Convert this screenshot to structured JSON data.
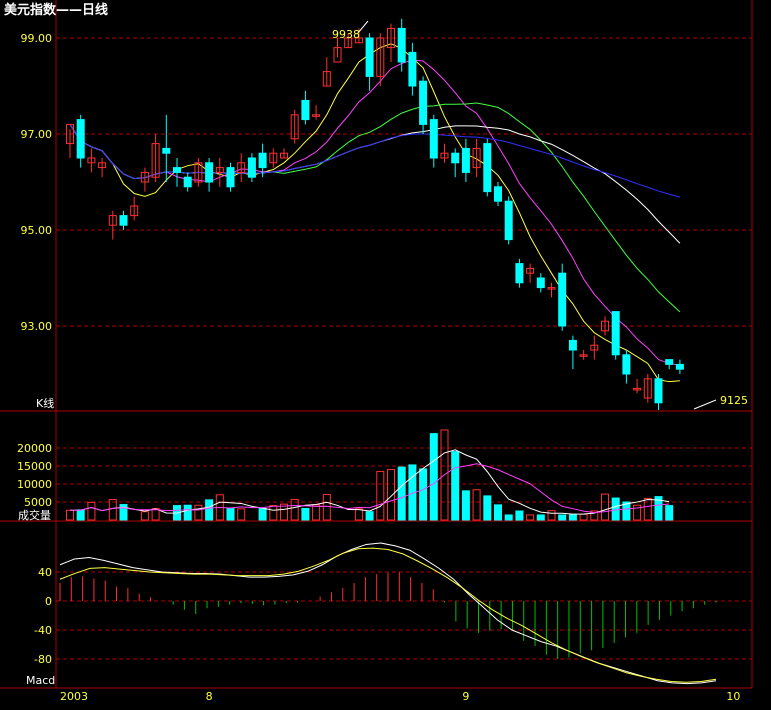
{
  "chart_data": {
    "type": "candlestick",
    "title": "美元指数——日线",
    "kline_label": "K线",
    "volume_label": "成交量",
    "macd_label": "Macd",
    "annotations": {
      "high": "9938",
      "low": "9125"
    },
    "price_axis": {
      "ticks": [
        "99.00",
        "97.00",
        "95.00",
        "93.00"
      ],
      "ylim": [
        91.0,
        99.6
      ]
    },
    "volume_axis": {
      "ticks": [
        "20000",
        "15000",
        "10000",
        "5000"
      ],
      "ylim": [
        0,
        25000
      ]
    },
    "macd_axis": {
      "ticks": [
        "40",
        "0",
        "-40",
        "-80"
      ],
      "ylim": [
        -116,
        80
      ]
    },
    "x_labels": [
      "2003",
      "8",
      "9",
      "10"
    ],
    "x_label_index": [
      0,
      13,
      37,
      62
    ],
    "colors": {
      "up": "#ff3030",
      "down": "#00ffff",
      "ma5": "#ffff40",
      "ma10": "#ff40ff",
      "ma20": "#40ff40",
      "ma30": "#ffffff",
      "ma60": "#3030ff",
      "macd_pos": "#ff3030",
      "macd_neg": "#00c000",
      "frame": "#b00000",
      "axis_text": "#ffff40",
      "label": "#ffffff"
    },
    "candles": [
      [
        96.8,
        97.2,
        96.5,
        97.1
      ],
      [
        97.3,
        96.5,
        96.3,
        97.4
      ],
      [
        96.4,
        96.5,
        96.2,
        96.7
      ],
      [
        96.3,
        96.4,
        96.1,
        96.5
      ],
      [
        95.1,
        95.3,
        94.8,
        95.4
      ],
      [
        95.3,
        95.1,
        95.0,
        95.4
      ],
      [
        95.3,
        95.5,
        95.2,
        95.7
      ],
      [
        96.0,
        96.2,
        95.8,
        96.3
      ],
      [
        96.1,
        96.8,
        96.0,
        97.0
      ],
      [
        96.7,
        96.6,
        96.0,
        97.4
      ],
      [
        96.3,
        96.2,
        95.9,
        96.5
      ],
      [
        96.1,
        95.9,
        95.8,
        96.2
      ],
      [
        96.0,
        96.4,
        95.9,
        96.5
      ],
      [
        96.4,
        96.0,
        95.8,
        96.5
      ],
      [
        96.2,
        96.3,
        95.9,
        96.5
      ],
      [
        96.3,
        95.9,
        95.8,
        96.4
      ],
      [
        96.2,
        96.4,
        96.0,
        96.6
      ],
      [
        96.5,
        96.1,
        96.0,
        96.6
      ],
      [
        96.6,
        96.3,
        96.1,
        96.8
      ],
      [
        96.4,
        96.6,
        96.3,
        96.7
      ],
      [
        96.5,
        96.6,
        96.5,
        96.7
      ],
      [
        96.9,
        97.4,
        96.8,
        97.5
      ],
      [
        97.7,
        97.3,
        97.2,
        97.9
      ],
      [
        97.4,
        97.4,
        97.3,
        97.6
      ],
      [
        98.0,
        98.3,
        98.0,
        98.6
      ],
      [
        98.5,
        98.8,
        98.6,
        99.0
      ],
      [
        98.8,
        99.0,
        98.8,
        99.1
      ],
      [
        98.9,
        99.0,
        98.9,
        99.2
      ],
      [
        99.0,
        98.2,
        97.9,
        99.1
      ],
      [
        98.2,
        99.0,
        98.0,
        99.1
      ],
      [
        98.8,
        99.2,
        98.5,
        99.3
      ],
      [
        99.2,
        98.5,
        98.3,
        99.4
      ],
      [
        98.7,
        98.0,
        97.8,
        98.9
      ],
      [
        98.1,
        97.2,
        97.0,
        98.2
      ],
      [
        97.3,
        96.5,
        96.3,
        97.4
      ],
      [
        96.5,
        96.6,
        96.4,
        96.8
      ],
      [
        96.6,
        96.4,
        96.1,
        96.7
      ],
      [
        96.7,
        96.2,
        96.0,
        96.9
      ],
      [
        96.3,
        96.7,
        96.1,
        96.9
      ],
      [
        96.8,
        95.8,
        95.7,
        96.9
      ],
      [
        95.9,
        95.6,
        95.5,
        96.0
      ],
      [
        95.6,
        94.8,
        94.7,
        95.7
      ],
      [
        94.3,
        93.9,
        93.8,
        94.4
      ],
      [
        94.1,
        94.2,
        93.9,
        94.3
      ],
      [
        94.0,
        93.8,
        93.7,
        94.1
      ],
      [
        93.8,
        93.8,
        93.6,
        93.9
      ],
      [
        94.1,
        93.0,
        92.9,
        94.3
      ],
      [
        92.7,
        92.5,
        92.1,
        92.8
      ],
      [
        92.4,
        92.4,
        92.3,
        92.5
      ],
      [
        92.5,
        92.6,
        92.3,
        92.8
      ],
      [
        92.9,
        93.1,
        92.8,
        93.2
      ],
      [
        93.3,
        92.4,
        92.3,
        93.3
      ],
      [
        92.4,
        92.0,
        91.8,
        92.5
      ],
      [
        91.7,
        91.7,
        91.6,
        91.9
      ],
      [
        91.5,
        91.9,
        91.4,
        92.0
      ],
      [
        91.9,
        91.4,
        91.25,
        92.0
      ],
      [
        92.3,
        92.2,
        92.1,
        92.3
      ],
      [
        92.2,
        92.1,
        92.0,
        92.3
      ]
    ],
    "volume": [
      2700,
      2800,
      4900,
      0,
      5700,
      4300,
      0,
      2300,
      3200,
      0,
      4000,
      4100,
      4100,
      5600,
      7000,
      3200,
      3100,
      0,
      3200,
      4000,
      4400,
      5700,
      3200,
      4200,
      7100,
      0,
      0,
      3100,
      2300,
      13500,
      14000,
      14700,
      15300,
      14200,
      24000,
      25000,
      19000,
      8100,
      8400,
      6700,
      4200,
      1400,
      2500,
      1400,
      1400,
      2600,
      1400,
      1400,
      1600,
      2500,
      7200,
      6100,
      5000,
      4100,
      6000,
      6500,
      4000
    ],
    "macd_hist": [
      25,
      33,
      34,
      31,
      28,
      20,
      18,
      10,
      5,
      0,
      -5,
      -12,
      -18,
      -10,
      -8,
      -5,
      -3,
      -4,
      -6,
      -5,
      -3,
      -2,
      0,
      6,
      12,
      18,
      25,
      33,
      37,
      39,
      40,
      33,
      25,
      16,
      -2,
      -28,
      -38,
      -44,
      -41,
      -39,
      -40,
      -55,
      -62,
      -74,
      -80,
      -78,
      -72,
      -68,
      -65,
      -58,
      -50,
      -44,
      -33,
      -26,
      -20,
      -14,
      -10,
      -5,
      -2
    ],
    "macd_dif": [
      50,
      58,
      60,
      56,
      51,
      46,
      43,
      40,
      39,
      38,
      38,
      37,
      35,
      33,
      33,
      34,
      36,
      41,
      50,
      62,
      71,
      78,
      80,
      76,
      70,
      58,
      45,
      30,
      10,
      -8,
      -26,
      -40,
      -48,
      -56,
      -62,
      -70,
      -78,
      -86,
      -92,
      -98,
      -104,
      -110,
      -113,
      -114,
      -113,
      -110
    ],
    "macd_dea": [
      30,
      38,
      45,
      46,
      44,
      42,
      40,
      39,
      38,
      37,
      37,
      36,
      35,
      35,
      35,
      37,
      41,
      48,
      56,
      66,
      72,
      73,
      71,
      65,
      55,
      44,
      32,
      18,
      2,
      -12,
      -24,
      -34,
      -46,
      -58,
      -68,
      -77,
      -85,
      -92,
      -99,
      -104,
      -108,
      -111,
      -112,
      -111,
      -108
    ]
  }
}
